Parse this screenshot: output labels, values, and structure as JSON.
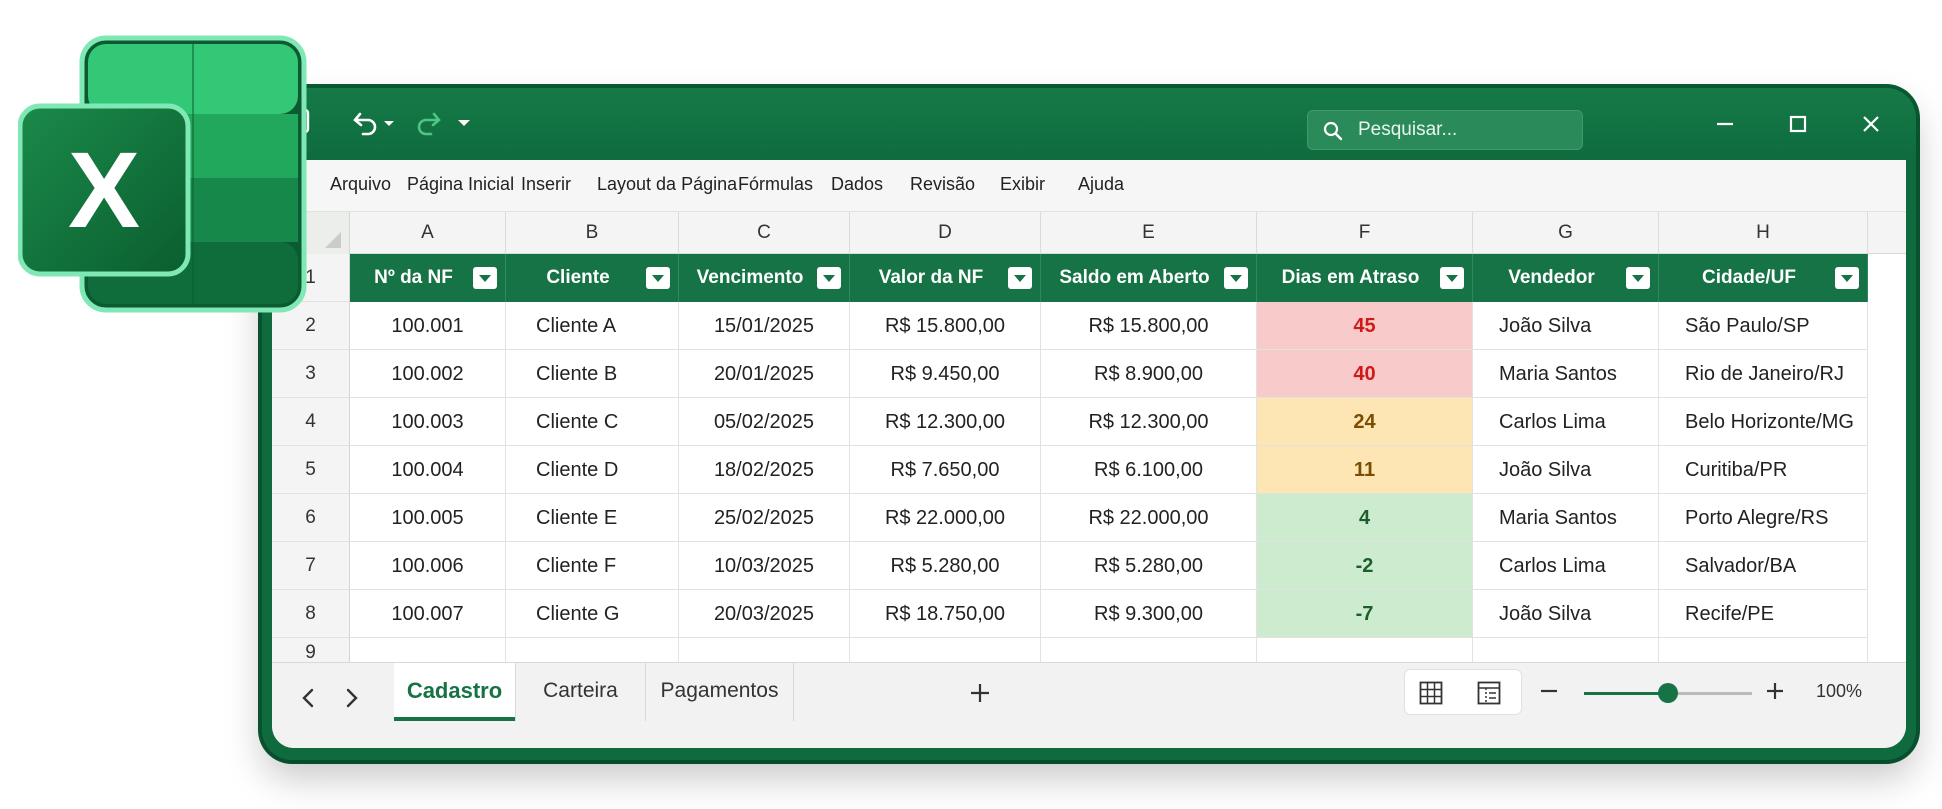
{
  "app": {
    "brand_color": "#157345",
    "logo_letter": "X"
  },
  "titlebar": {
    "icons": [
      "save-icon",
      "undo-icon",
      "redo-icon",
      "customize-dropdown-icon"
    ],
    "search_placeholder": "Pesquisar...",
    "window_controls": [
      "minimize-icon",
      "maximize-icon",
      "close-icon"
    ]
  },
  "menu": {
    "items": [
      "Arquivo",
      "Página Inicial",
      "Inserir",
      "Layout da Página",
      "Fórmulas",
      "Dados",
      "Revisão",
      "Exibir",
      "Ajuda"
    ]
  },
  "sheet": {
    "column_letters": [
      "A",
      "B",
      "C",
      "D",
      "E",
      "F",
      "G",
      "H"
    ],
    "row_numbers": [
      "1",
      "2",
      "3",
      "4",
      "5",
      "6",
      "7",
      "8",
      "9"
    ],
    "headers": [
      "Nº da NF",
      "Cliente",
      "Vencimento",
      "Valor da NF",
      "Saldo em Aberto",
      "Dias em Atraso",
      "Vendedor",
      "Cidade/UF"
    ],
    "rows": [
      [
        "100.001",
        "Cliente A",
        "15/01/2025",
        "R$ 15.800,00",
        "R$ 15.800,00",
        "45",
        "João Silva",
        "São Paulo/SP"
      ],
      [
        "100.002",
        "Cliente B",
        "20/01/2025",
        "R$ 9.450,00",
        "R$ 8.900,00",
        "40",
        "Maria Santos",
        "Rio de Janeiro/RJ"
      ],
      [
        "100.003",
        "Cliente C",
        "05/02/2025",
        "R$ 12.300,00",
        "R$ 12.300,00",
        "24",
        "Carlos Lima",
        "Belo Horizonte/MG"
      ],
      [
        "100.004",
        "Cliente D",
        "18/02/2025",
        "R$ 7.650,00",
        "R$  6.100,00",
        "11",
        "João Silva",
        "Curitiba/PR"
      ],
      [
        "100.005",
        "Cliente E",
        "25/02/2025",
        "R$ 22.000,00",
        "R$ 22.000,00",
        "4",
        "Maria Santos",
        "Porto Alegre/RS"
      ],
      [
        "100.006",
        "Cliente F",
        "10/03/2025",
        "R$ 5.280,00",
        "R$ 5.280,00",
        "-2",
        "Carlos Lima",
        "Salvador/BA"
      ],
      [
        "100.007",
        "Cliente G",
        "20/03/2025",
        "R$ 18.750,00",
        "R$ 9.300,00",
        "-7",
        "João Silva",
        "Recife/PE"
      ]
    ],
    "delay_status": [
      "red",
      "red",
      "yellow",
      "yellow",
      "green",
      "green",
      "green"
    ],
    "status_colors": {
      "red": "#f8caca",
      "yellow": "#fde6b3",
      "green": "#cdebcf"
    }
  },
  "sheetbar": {
    "tabs": [
      {
        "label": "Cadastro",
        "active": true
      },
      {
        "label": "Carteira",
        "active": false
      },
      {
        "label": "Pagamentos",
        "active": false
      }
    ],
    "add_tab_icon": "plus-icon",
    "view_icons": [
      "normal-view-icon",
      "page-layout-view-icon"
    ],
    "zoom_level_fraction": 0.5,
    "zoom_label": "100%"
  }
}
